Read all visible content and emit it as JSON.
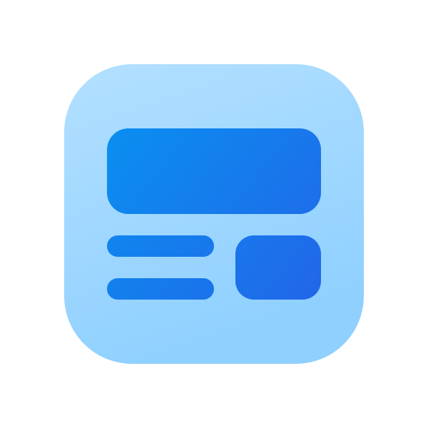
{
  "icon": {
    "name": "layout-dashboard-icon",
    "colors": {
      "tile_light": "#B3E0FF",
      "tile_dark": "#8FD0FF",
      "mark_start": "#0A8FF0",
      "mark_end": "#2266E8"
    }
  }
}
